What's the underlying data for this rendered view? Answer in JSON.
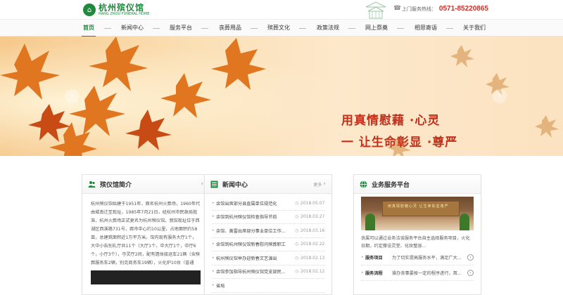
{
  "header": {
    "logo_cn": "杭州殡仪馆",
    "logo_en": "HANG ZHOU FUNERAL HOME",
    "hotline_label": "上门服务热线：",
    "hotline_number": "0571-85220865"
  },
  "nav": {
    "items": [
      {
        "label": "首页",
        "active": true
      },
      {
        "label": "新闻中心"
      },
      {
        "label": "服务平台"
      },
      {
        "label": "丧葬用品"
      },
      {
        "label": "殡葬文化"
      },
      {
        "label": "政策法规"
      },
      {
        "label": "网上祭奠"
      },
      {
        "label": "相思寄语"
      },
      {
        "label": "关于我们"
      }
    ]
  },
  "banner": {
    "slogan_line1": "用真情慰藉 ·心灵",
    "slogan_line2": "一    让生命彰显 ·尊严",
    "prev": "‹",
    "next": "›"
  },
  "intro": {
    "title": "殡仪馆简介",
    "text": "杭州殡仪馆始建于1951年，原名杭州火葬场，1960年代由城南迁至现址，1985年7月21日，经杭州市民政局批准，杭州火葬场正式更名为杭州殡仪馆。我馆现址位于西湖区西溪路731号，距市中心约10公里，占地面积约58亩，总建筑面积近1万平方米。馆内现有服务大厅1个，大中小告别礼厅共11个（大厅1个，中大厅1个，中厅6个，小厅3个），守灵厅2间，配有遗体接运车21辆（含殡葬服务车2辆，别克商务车19辆），火化炉10台（普通"
  },
  "news": {
    "title": "新闻中心",
    "more": "更多",
    "items": [
      {
        "title": "余馆出席部分县直属单位规范化",
        "date": "2018.05.07"
      },
      {
        "title": "余馆到杭州殡仪馆检查指导节前",
        "date": "2018.03.27"
      },
      {
        "title": "余馆、黄雷出席部分事业单位工作...",
        "date": "2018.03.16"
      },
      {
        "title": "余馆到杭州殡仪馆新春慰问殡葬职工",
        "date": "2018.02.22"
      },
      {
        "title": "杭州殡仪馆举办迎新春文艺演出",
        "date": "2018.02.13"
      },
      {
        "title": "余馆参加指导杭州殡仪馆党支部民...",
        "date": "2018.02.12"
      },
      {
        "title": "省局"
      }
    ]
  },
  "service": {
    "title": "业务服务平台",
    "photo_text": "用真情慰藉心灵 让生命彰显尊严",
    "desc": "丧属可以通过业务洽谈服务平台自主选择服务项目，火化日期，约定撑设灵堂、化妆整容...",
    "rows": [
      {
        "key": "服务项目",
        "value": "为了切实提高服务水平，满足广大..."
      },
      {
        "key": "服务流程",
        "value": "操办丧事要按一定的程序进行，首..."
      }
    ]
  },
  "colors": {
    "brand_green": "#1f8a3d",
    "hotline_red": "#d32d24",
    "slogan_red": "#c0311c"
  }
}
